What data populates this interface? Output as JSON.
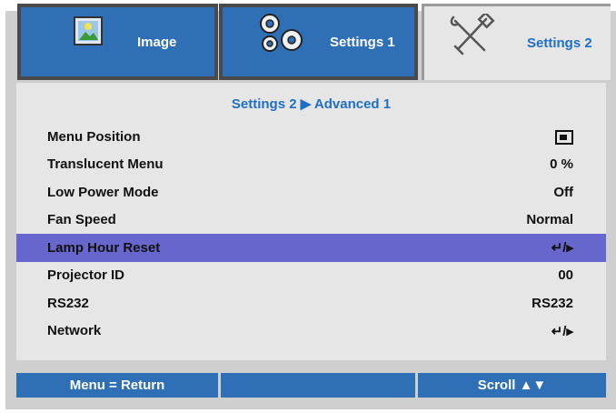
{
  "tabs": [
    {
      "label": "Image",
      "icon": "image-icon",
      "active": false
    },
    {
      "label": "Settings 1",
      "icon": "gears-icon",
      "active": false
    },
    {
      "label": "Settings 2",
      "icon": "tools-icon",
      "active": true
    }
  ],
  "breadcrumb": "Settings 2 ▶ Advanced 1",
  "rows": [
    {
      "label": "Menu Position",
      "value": "",
      "icon": "menu-position-icon"
    },
    {
      "label": "Translucent Menu",
      "value": "0 %"
    },
    {
      "label": "Low Power Mode",
      "value": "Off"
    },
    {
      "label": "Fan Speed",
      "value": "Normal"
    },
    {
      "label": "Lamp Hour Reset",
      "value": "↵/▸",
      "selected": true
    },
    {
      "label": "Projector ID",
      "value": "00"
    },
    {
      "label": "RS232",
      "value": "RS232"
    },
    {
      "label": "Network",
      "value": "↵/▸"
    }
  ],
  "footer": {
    "left": "Menu = Return",
    "middle": "",
    "right": "Scroll ▲▼"
  },
  "colors": {
    "tab_blue": "#2f6fb6",
    "accent_text": "#1f6fc6",
    "selected_row": "#6666cc",
    "panel_bg": "#e6e6e6",
    "frame_bg": "#cfcfcf"
  }
}
